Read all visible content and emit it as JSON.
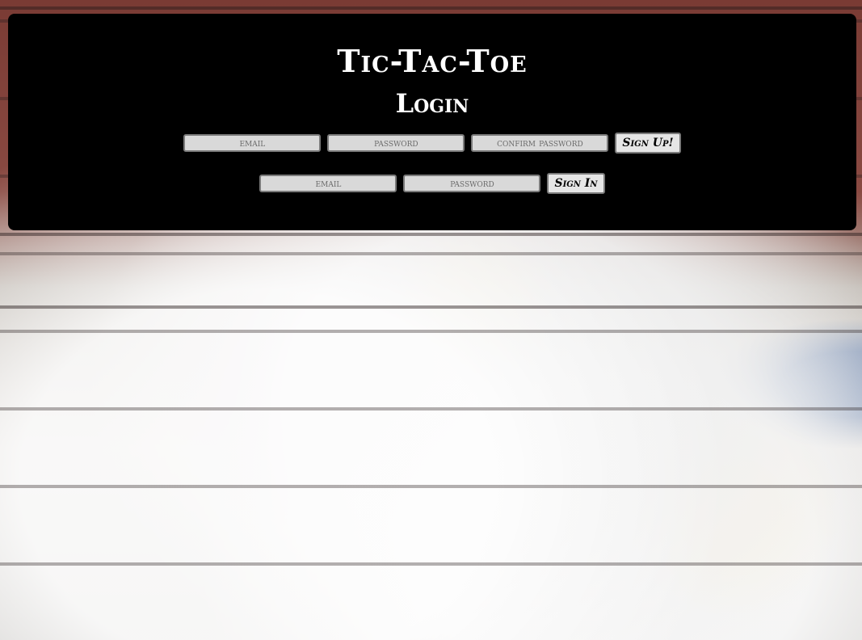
{
  "header": {
    "title": "Tic-Tac-Toe",
    "subtitle": "Login"
  },
  "signup": {
    "email_placeholder": "email",
    "password_placeholder": "password",
    "confirm_placeholder": "confirm password",
    "button_label": "Sign Up!"
  },
  "signin": {
    "email_placeholder": "email",
    "password_placeholder": "password",
    "button_label": "Sign In"
  }
}
